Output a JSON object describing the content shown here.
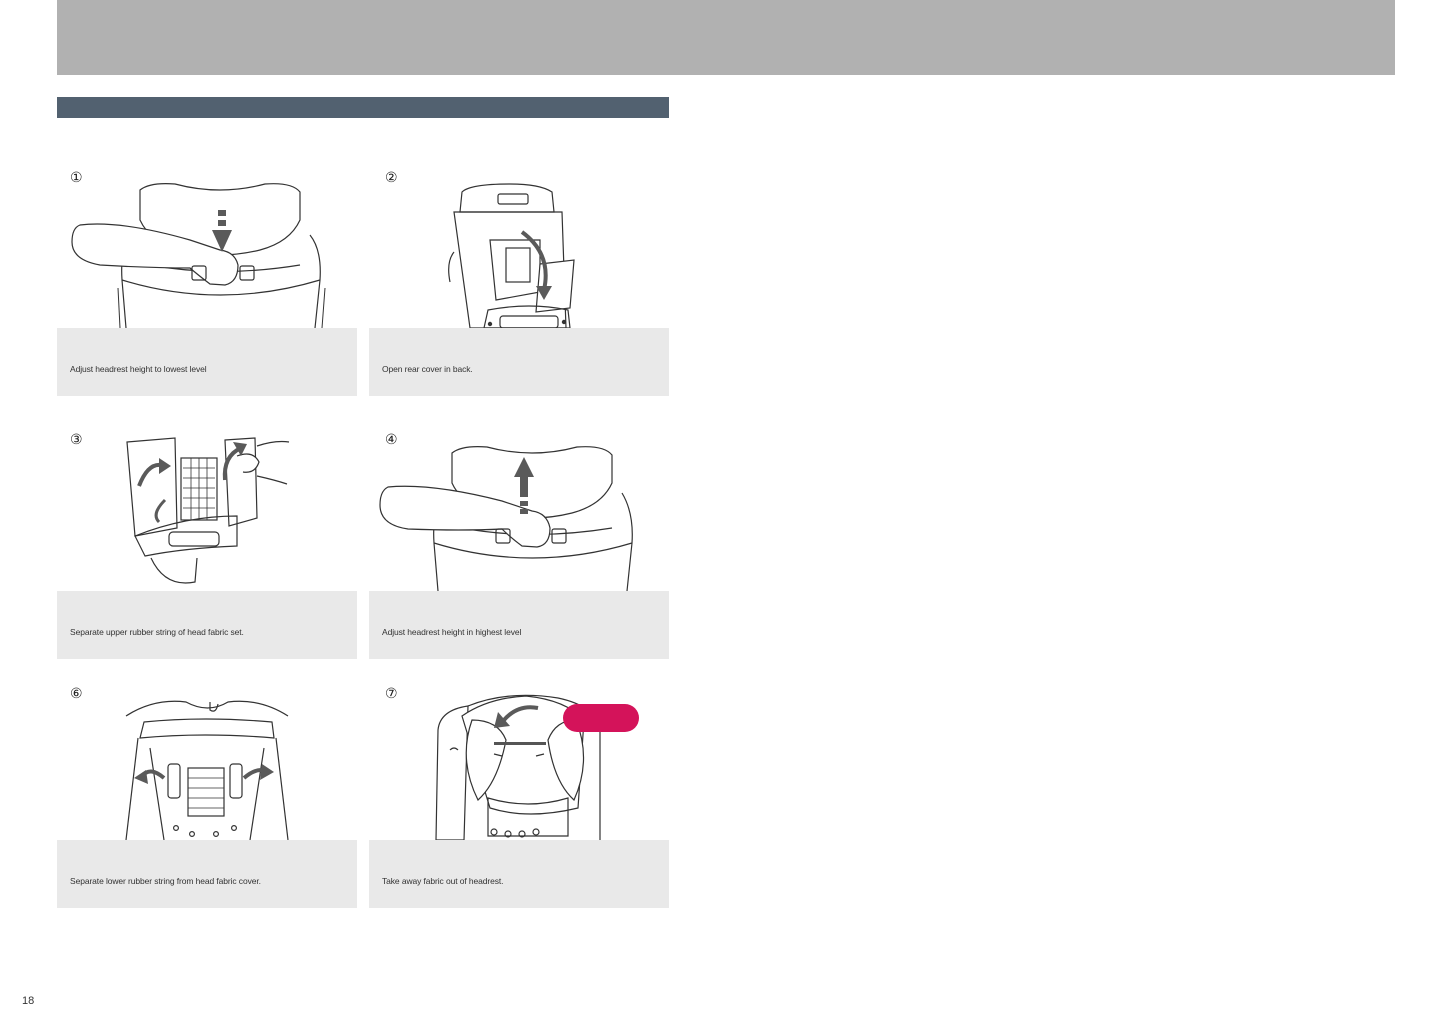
{
  "page": {
    "number": "18"
  },
  "steps": [
    {
      "marker": "①",
      "caption": "Adjust headrest height to lowest level"
    },
    {
      "marker": "②",
      "caption": "Open rear cover in back."
    },
    {
      "marker": "③",
      "caption": "Separate upper rubber string of head fabric set."
    },
    {
      "marker": "④",
      "caption": "Adjust headrest height in highest level"
    },
    {
      "marker": "⑥",
      "caption": "Separate lower rubber string from head fabric cover."
    },
    {
      "marker": "⑦",
      "caption": "Take away fabric out of headrest."
    }
  ],
  "colors": {
    "top_band": "#b1b1b1",
    "section_bar": "#526170",
    "caption_bg": "#e9e9e9",
    "arrow": "#5a5a5a",
    "accent_tab": "#d4135a"
  }
}
